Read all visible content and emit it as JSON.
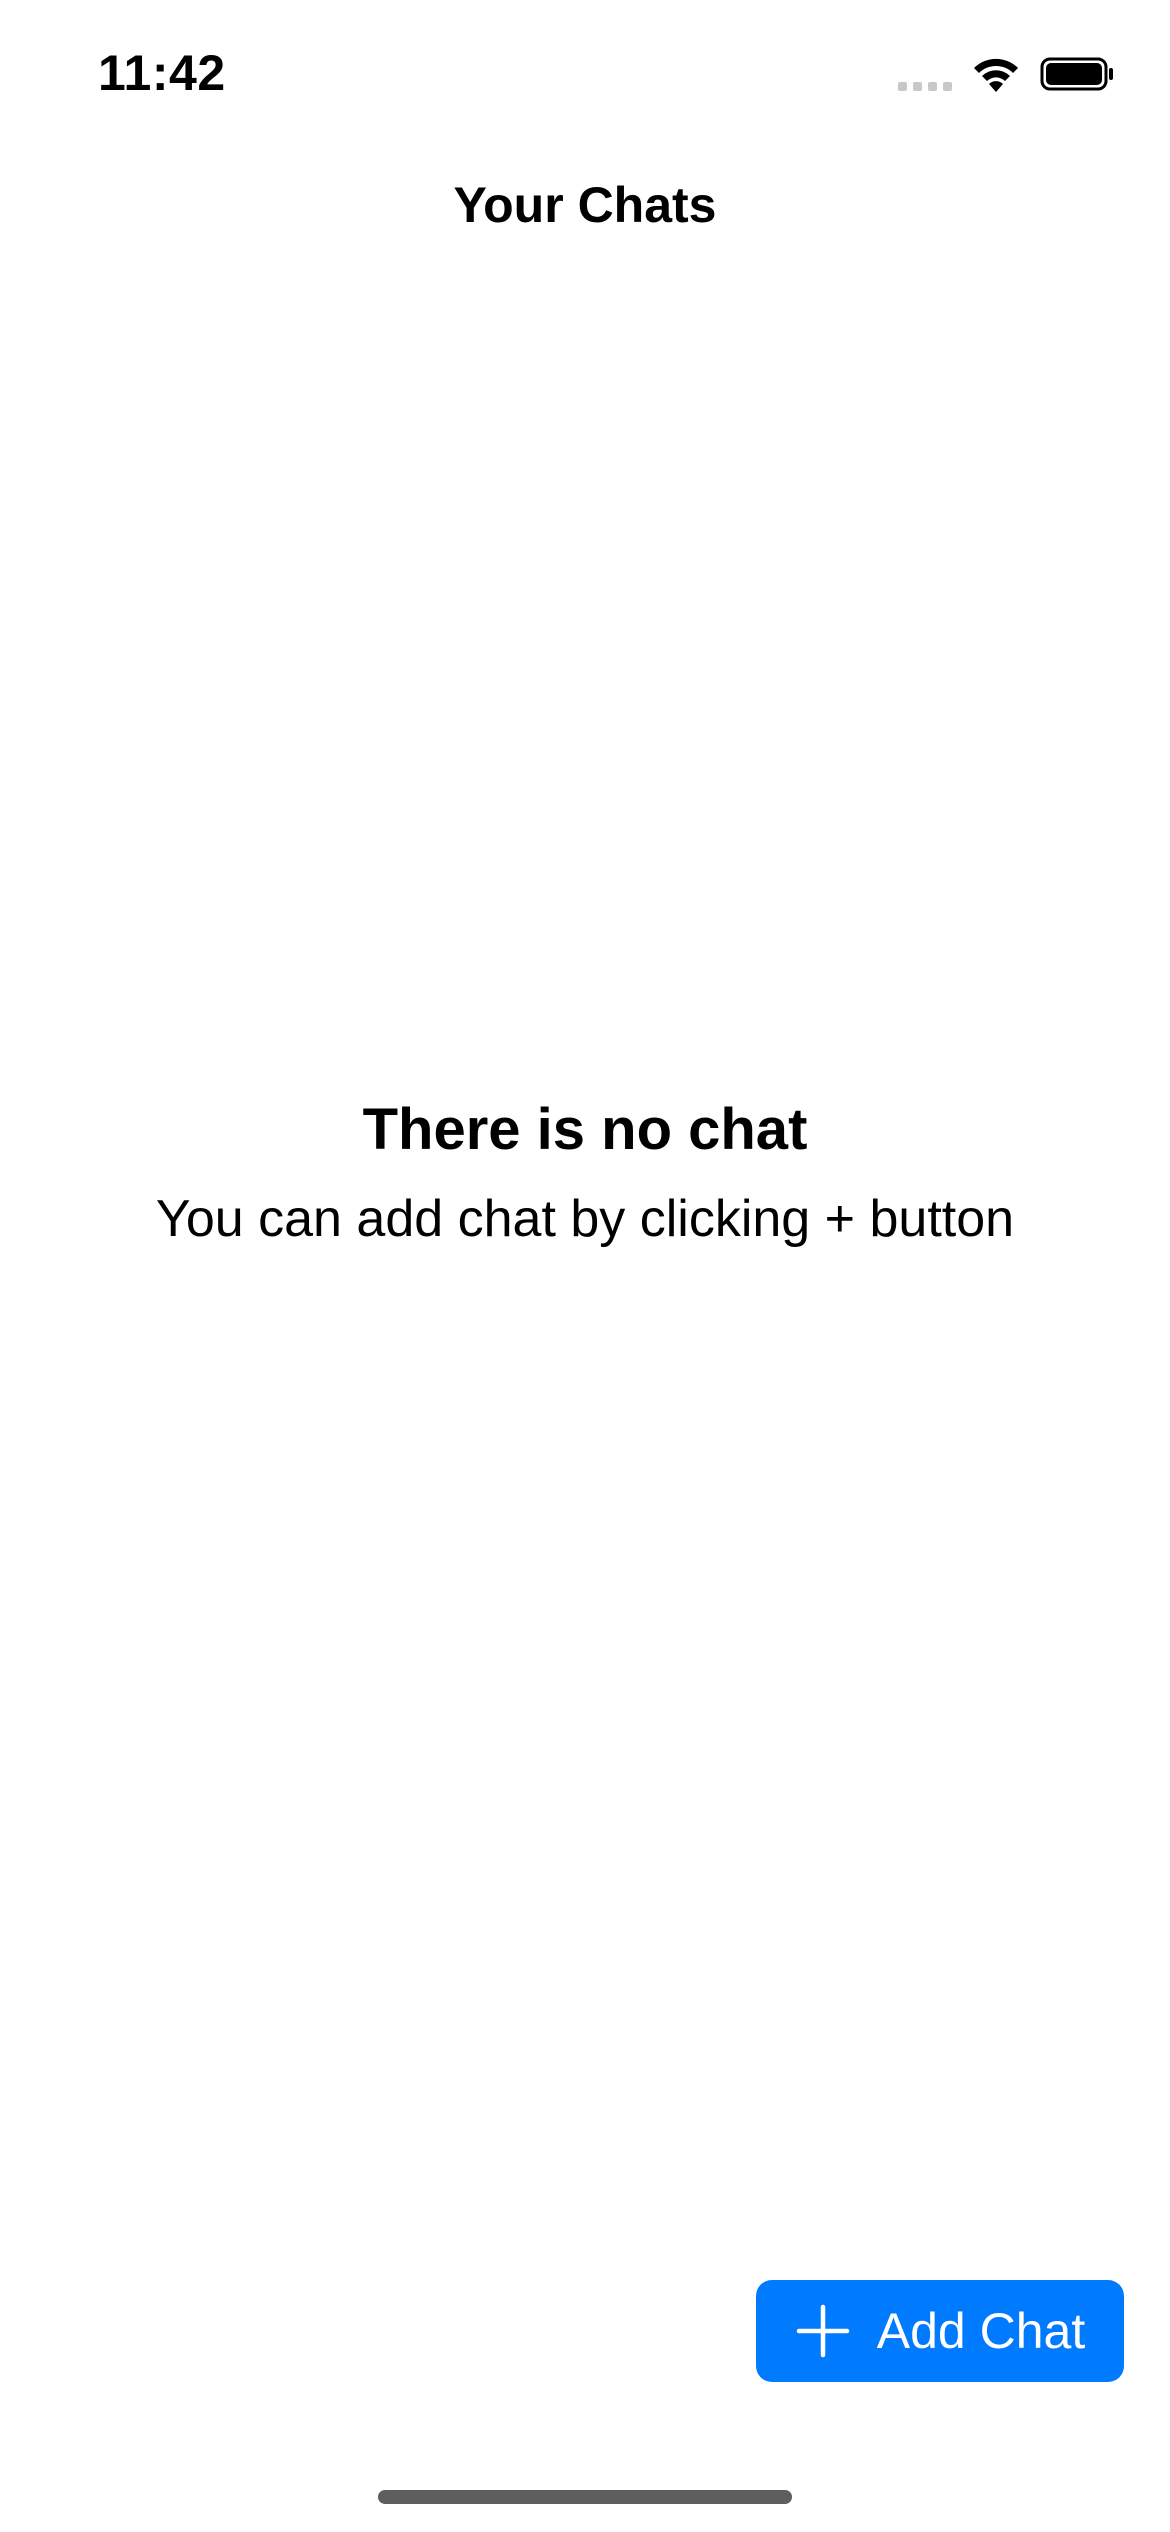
{
  "status_bar": {
    "time": "11:42",
    "icons": [
      "cellular-signal-icon",
      "wifi-icon",
      "battery-icon"
    ]
  },
  "nav": {
    "title": "Your Chats"
  },
  "empty_state": {
    "title": "There is no chat",
    "subtitle": "You can add chat by clicking + button"
  },
  "add_chat_button": {
    "label": "Add Chat",
    "icon": "plus-icon",
    "color": "#007aff"
  },
  "colors": {
    "background": "#ffffff",
    "accent": "#007aff",
    "text": "#000000"
  }
}
